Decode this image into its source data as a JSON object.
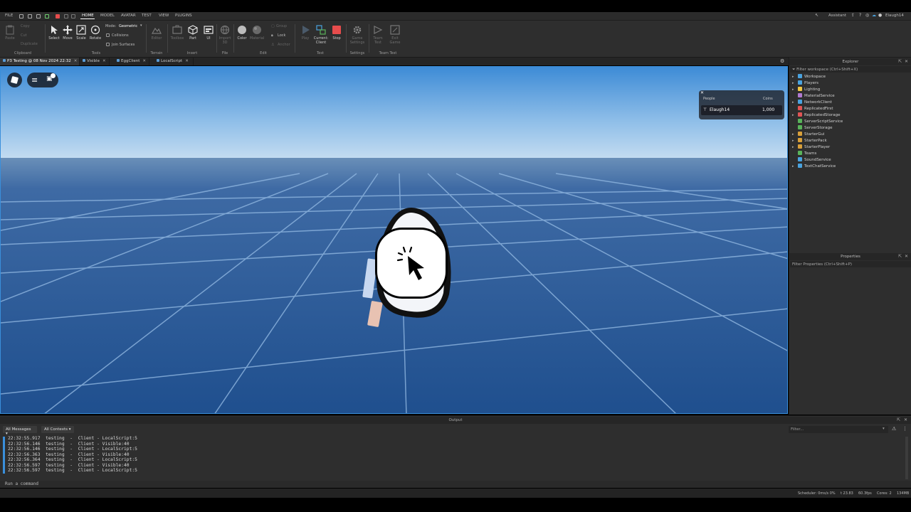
{
  "menu": {
    "file": "FILE",
    "tabs": [
      "HOME",
      "MODEL",
      "AVATAR",
      "TEST",
      "VIEW",
      "PLUGINS"
    ],
    "active_tab": "HOME",
    "assistant": "Assistant",
    "user": "Elaugh14"
  },
  "ribbon": {
    "clipboard": {
      "paste": "Paste",
      "copy": "Copy",
      "cut": "Cut",
      "duplicate": "Duplicate",
      "group": "Clipboard"
    },
    "tools": {
      "select": "Select",
      "move": "Move",
      "scale": "Scale",
      "rotate": "Rotate",
      "mode_label": "Mode:",
      "mode_value": "Geometric",
      "collisions": "Collisions",
      "join_surfaces": "Join Surfaces",
      "group": "Tools"
    },
    "terrain": {
      "editor": "Editor",
      "group": "Terrain"
    },
    "insert": {
      "toolbox": "Toolbox",
      "part": "Part",
      "ui": "UI",
      "group": "Insert"
    },
    "file": {
      "import3d": "Import 3D",
      "group": "File"
    },
    "edit": {
      "color": "Color",
      "material": "Material",
      "group_btn": "Group",
      "lock": "Lock",
      "anchor": "Anchor",
      "group": "Edit"
    },
    "test": {
      "play": "Play",
      "current": "Current:",
      "client": "Client",
      "stop": "Stop",
      "group": "Test"
    },
    "settings": {
      "game_settings": "Game Settings",
      "group": "Settings"
    },
    "team_test": {
      "team_test": "Team Test",
      "exit_game": "Exit Game",
      "group": "Team Test"
    }
  },
  "doc_tabs": [
    {
      "label": "P3 Testing @ 08 Nov 2024 22:32",
      "active": true
    },
    {
      "label": "Visible",
      "active": false
    },
    {
      "label": "EggClient",
      "active": false
    },
    {
      "label": "LocalScript",
      "active": false
    }
  ],
  "leaderboard": {
    "col_people": "People",
    "col_coins": "Coins",
    "player_name": "Elaugh14",
    "coins": "1,000"
  },
  "explorer": {
    "title": "Explorer",
    "filter_placeholder": "Filter workspace (Ctrl+Shift+X)",
    "items": [
      {
        "label": "Workspace",
        "color": "#4aa3df",
        "expandable": true
      },
      {
        "label": "Players",
        "color": "#4aa3df",
        "expandable": true
      },
      {
        "label": "Lighting",
        "color": "#f2c744",
        "expandable": true
      },
      {
        "label": "MaterialService",
        "color": "#b07ad1",
        "expandable": false
      },
      {
        "label": "NetworkClient",
        "color": "#4aa3df",
        "expandable": true
      },
      {
        "label": "ReplicatedFirst",
        "color": "#e05555",
        "expandable": false
      },
      {
        "label": "ReplicatedStorage",
        "color": "#e05555",
        "expandable": true
      },
      {
        "label": "ServerScriptService",
        "color": "#59b35a",
        "expandable": false
      },
      {
        "label": "ServerStorage",
        "color": "#59b35a",
        "expandable": false
      },
      {
        "label": "StarterGui",
        "color": "#d9a03a",
        "expandable": true
      },
      {
        "label": "StarterPack",
        "color": "#d9a03a",
        "expandable": true
      },
      {
        "label": "StarterPlayer",
        "color": "#d9a03a",
        "expandable": true
      },
      {
        "label": "Teams",
        "color": "#59b35a",
        "expandable": false
      },
      {
        "label": "SoundService",
        "color": "#4aa3df",
        "expandable": false
      },
      {
        "label": "TextChatService",
        "color": "#4aa3df",
        "expandable": true
      }
    ]
  },
  "properties": {
    "title": "Properties",
    "filter_placeholder": "Filter Properties (Ctrl+Shift+P)"
  },
  "output": {
    "title": "Output",
    "messages_filter": "All Messages",
    "contexts_filter": "All Contexts",
    "search_placeholder": "Filter...",
    "logs": [
      "22:32:55.917  testing  -  Client - LocalScript:5",
      "22:32:56.146  testing  -  Client - Visible:40",
      "22:32:56.146  testing  -  Client - LocalScript:5",
      "22:32:56.363  testing  -  Client - Visible:40",
      "22:32:56.364  testing  -  Client - LocalScript:5",
      "22:32:56.597  testing  -  Client - Visible:40",
      "22:32:56.597  testing  -  Client - LocalScript:5"
    ],
    "command_placeholder": "Run a command"
  },
  "status": {
    "scheduler": "Scheduler: 0ms/s 0%",
    "t": "t 23.83",
    "fps": "60.3fps",
    "cores": "Cores: 2",
    "mem": "134MB"
  },
  "colors": {
    "accent": "#3a8fdb",
    "stop_red": "#e74c4c",
    "sky_top": "#3f8fd8",
    "ground": "#2a5a9a"
  }
}
